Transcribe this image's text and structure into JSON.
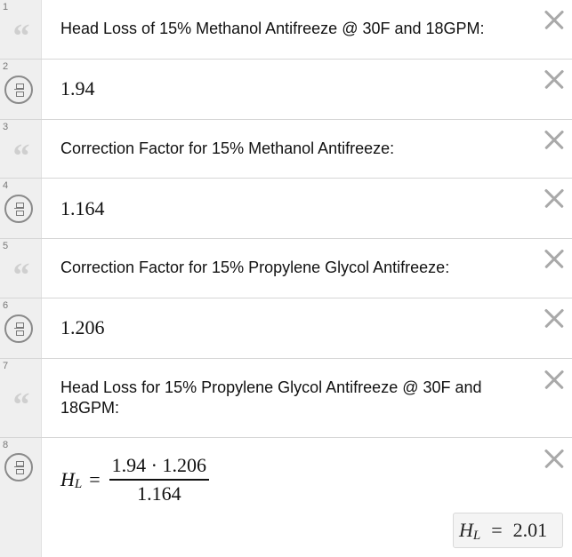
{
  "expressions": [
    {
      "number": "1",
      "kind": "note",
      "text": "Head Loss of 15% Methanol Antifreeze @ 30F and 18GPM:"
    },
    {
      "number": "2",
      "kind": "math",
      "value": "1.94"
    },
    {
      "number": "3",
      "kind": "note",
      "text": "Correction Factor for 15% Methanol Antifreeze:"
    },
    {
      "number": "4",
      "kind": "math",
      "value": "1.164"
    },
    {
      "number": "5",
      "kind": "note",
      "text": "Correction Factor for 15% Propylene Glycol Antifreeze:"
    },
    {
      "number": "6",
      "kind": "math",
      "value": "1.206"
    },
    {
      "number": "7",
      "kind": "note",
      "text": "Head Loss for 15% Propylene Glycol Antifreeze @ 30F and 18GPM:"
    },
    {
      "number": "8",
      "kind": "formula",
      "lhs_var": "H",
      "lhs_sub": "L",
      "equals": "=",
      "numerator": "1.94 · 1.206",
      "denominator": "1.164",
      "result": {
        "var": "H",
        "sub": "L",
        "equals": "=",
        "value": "2.01"
      }
    }
  ],
  "icons": {
    "note": "quote-icon",
    "math": "calculator-icon",
    "delete": "close-icon"
  }
}
